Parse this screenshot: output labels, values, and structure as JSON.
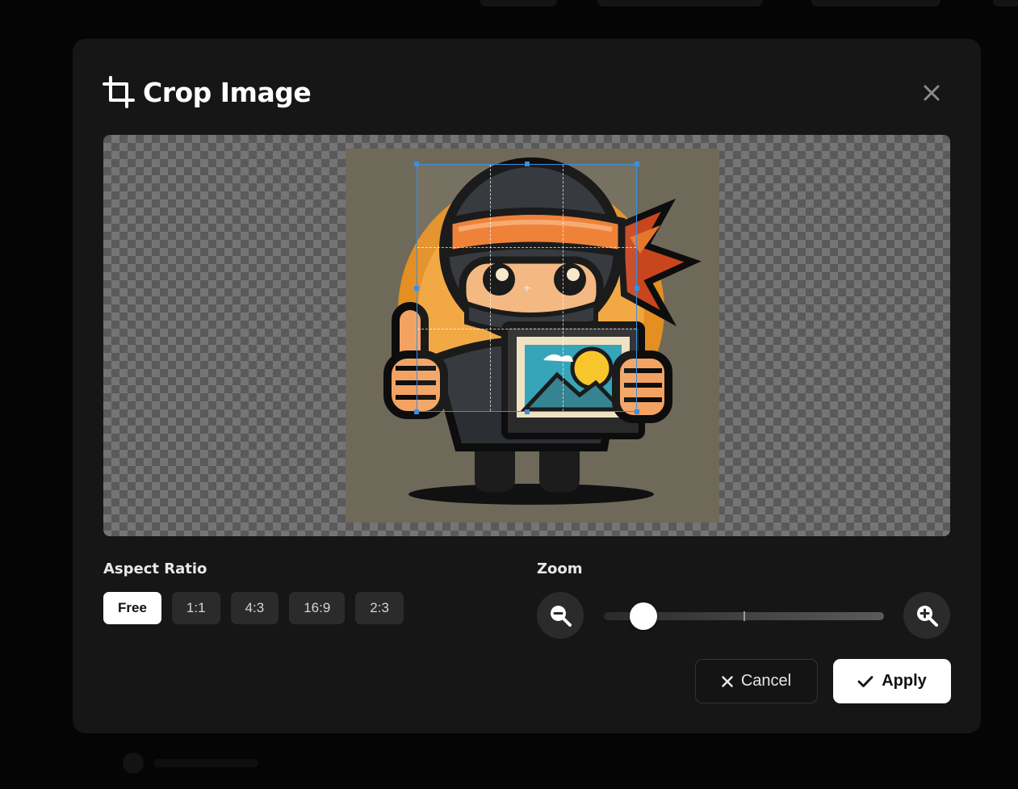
{
  "modal": {
    "title": "Crop Image",
    "title_icon": "crop-icon",
    "close_icon": "close-icon"
  },
  "aspect_ratio": {
    "label": "Aspect Ratio",
    "options": [
      "Free",
      "1:1",
      "4:3",
      "16:9",
      "2:3"
    ],
    "selected": "Free"
  },
  "zoom": {
    "label": "Zoom",
    "zoom_out_icon": "zoom-out-icon",
    "zoom_in_icon": "zoom-in-icon",
    "level_fraction": 0.14
  },
  "actions": {
    "cancel_label": "Cancel",
    "apply_label": "Apply"
  },
  "colors": {
    "crop_border": "#3b8fe0",
    "modal_bg": "#161616",
    "active_ratio_bg": "#ffffff"
  }
}
